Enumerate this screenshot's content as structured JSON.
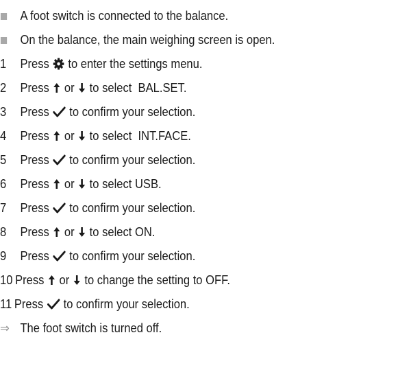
{
  "prerequisites": [
    "A foot switch is connected to the balance.",
    "On the balance, the main weighing screen is open."
  ],
  "steps": [
    {
      "num": "1",
      "press": "Press",
      "icon": "gear-icon",
      "rest": "to enter the settings menu."
    },
    {
      "num": "2",
      "press": "Press",
      "icon": "up-arrow-icon",
      "or": "or",
      "icon2": "down-arrow-icon",
      "rest": "to select  BAL.SET."
    },
    {
      "num": "3",
      "press": "Press",
      "icon": "checkmark-icon",
      "rest": "to confirm your selection."
    },
    {
      "num": "4",
      "press": "Press",
      "icon": "up-arrow-icon",
      "or": "or",
      "icon2": "down-arrow-icon",
      "rest": "to select  INT.FACE."
    },
    {
      "num": "5",
      "press": "Press",
      "icon": "checkmark-icon",
      "rest": "to confirm your selection."
    },
    {
      "num": "6",
      "press": "Press",
      "icon": "up-arrow-icon",
      "or": "or",
      "icon2": "down-arrow-icon",
      "rest": "to select USB."
    },
    {
      "num": "7",
      "press": "Press",
      "icon": "checkmark-icon",
      "rest": "to confirm your selection."
    },
    {
      "num": "8",
      "press": "Press",
      "icon": "up-arrow-icon",
      "or": "or",
      "icon2": "down-arrow-icon",
      "rest": "to select ON."
    },
    {
      "num": "9",
      "press": "Press",
      "icon": "checkmark-icon",
      "rest": "to confirm your selection."
    },
    {
      "num": "10",
      "press": "Press",
      "icon": "up-arrow-icon",
      "or": "or",
      "icon2": "down-arrow-icon",
      "rest": "to change the setting to OFF."
    },
    {
      "num": "11",
      "press": "Press",
      "icon": "checkmark-icon",
      "rest": "to confirm your selection."
    }
  ],
  "result": {
    "marker": "⇒",
    "text": "The foot switch is turned off."
  },
  "colors": {
    "text": "#1a1a1a",
    "bullet": "#a8a8a8",
    "result_arrow": "#9a9a9a"
  }
}
